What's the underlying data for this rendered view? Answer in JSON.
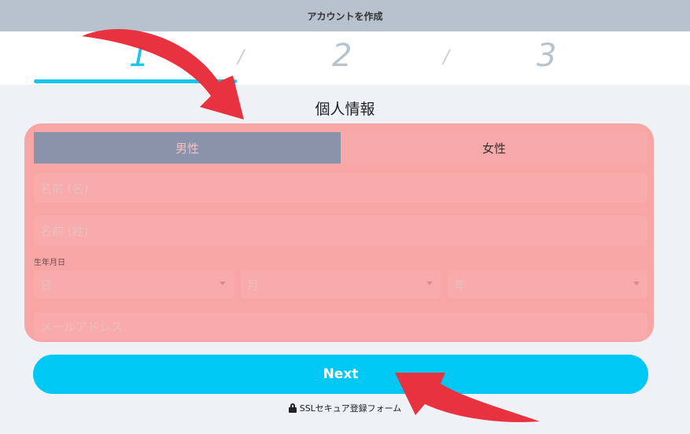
{
  "window": {
    "title": "アカウントを作成"
  },
  "steps": [
    {
      "label": "1"
    },
    {
      "label": "2"
    },
    {
      "label": "3"
    }
  ],
  "step_separator": "/",
  "section": {
    "title": "個人情報"
  },
  "gender": {
    "male": "男性",
    "female": "女性",
    "selected": "male"
  },
  "form": {
    "first_name": {
      "placeholder": "名前 (名)"
    },
    "last_name": {
      "placeholder": "名前 (姓)"
    },
    "dob_label": "生年月日",
    "day": {
      "value": "日"
    },
    "month": {
      "value": "月"
    },
    "year": {
      "value": "年"
    },
    "email": {
      "placeholder": "メールアドレス"
    }
  },
  "next_button": {
    "label": "Next"
  },
  "ssl_note": {
    "text": "SSLセキュア登録フォーム"
  },
  "colors": {
    "accent": "#00c8f5",
    "highlight_overlay": "#f8a5a5",
    "arrow": "#e8323f"
  }
}
